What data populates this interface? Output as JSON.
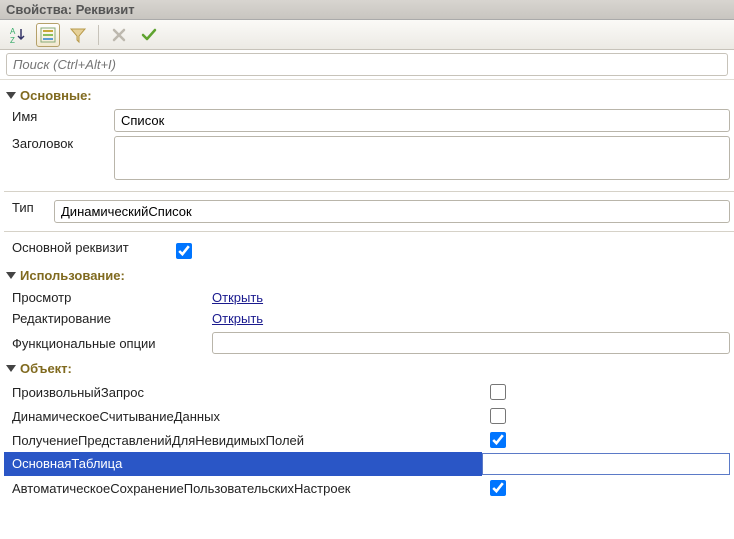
{
  "window": {
    "title": "Свойства: Реквизит"
  },
  "toolbar": {
    "sort_icon": "sort-alpha",
    "categorized_icon": "categorized",
    "filter_icon": "funnel",
    "clear_icon": "x",
    "confirm_icon": "check"
  },
  "search": {
    "placeholder": "Поиск (Ctrl+Alt+I)"
  },
  "sections": {
    "main": {
      "title": "Основные:",
      "name_label": "Имя",
      "name_value": "Список",
      "title_label": "Заголовок",
      "title_value": "",
      "type_label": "Тип",
      "type_value": "ДинамическийСписок",
      "main_attr_label": "Основной реквизит",
      "main_attr_checked": true
    },
    "usage": {
      "title": "Использование:",
      "view_label": "Просмотр",
      "view_link": "Открыть",
      "edit_label": "Редактирование",
      "edit_link": "Открыть",
      "funcopts_label": "Функциональные опции",
      "funcopts_value": ""
    },
    "object": {
      "title": "Объект:",
      "rows": [
        {
          "label": "ПроизвольныйЗапрос",
          "checked": false
        },
        {
          "label": "ДинамическоеСчитываниеДанных",
          "checked": false
        },
        {
          "label": "ПолучениеПредставленийДляНевидимыхПолей",
          "checked": true
        },
        {
          "label": "ОсновнаяТаблица",
          "input": "",
          "selected": true
        },
        {
          "label": "АвтоматическоеСохранениеПользовательскихНастроек",
          "checked": true
        }
      ]
    }
  }
}
